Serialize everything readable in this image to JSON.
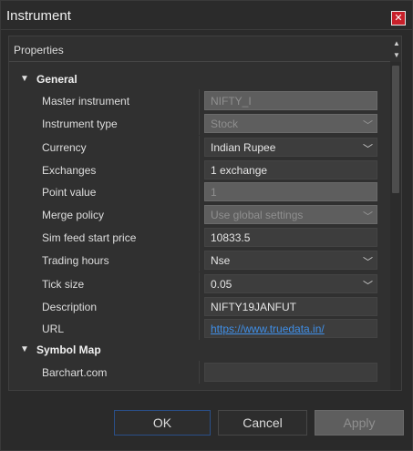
{
  "window": {
    "title": "Instrument"
  },
  "panel": {
    "header": "Properties"
  },
  "sections": {
    "general": {
      "label": "General"
    },
    "symbol_map": {
      "label": "Symbol Map"
    }
  },
  "properties": {
    "master_instrument": {
      "label": "Master instrument",
      "value": "NIFTY_I"
    },
    "instrument_type": {
      "label": "Instrument type",
      "value": "Stock"
    },
    "currency": {
      "label": "Currency",
      "value": "Indian Rupee"
    },
    "exchanges": {
      "label": "Exchanges",
      "value": "1 exchange"
    },
    "point_value": {
      "label": "Point value",
      "value": "1"
    },
    "merge_policy": {
      "label": "Merge policy",
      "value": "Use global settings"
    },
    "sim_feed_start_price": {
      "label": "Sim feed start price",
      "value": "10833.5"
    },
    "trading_hours": {
      "label": "Trading hours",
      "value": "Nse"
    },
    "tick_size": {
      "label": "Tick size",
      "value": "0.05"
    },
    "description": {
      "label": "Description",
      "value": "NIFTY19JANFUT"
    },
    "url": {
      "label": "URL",
      "value": "https://www.truedata.in/"
    },
    "barchart": {
      "label": "Barchart.com",
      "value": ""
    }
  },
  "buttons": {
    "ok": "OK",
    "cancel": "Cancel",
    "apply": "Apply"
  },
  "colors": {
    "close_button": "#c8202a",
    "link": "#3f8fe8",
    "ok_border": "#2a4f88"
  }
}
